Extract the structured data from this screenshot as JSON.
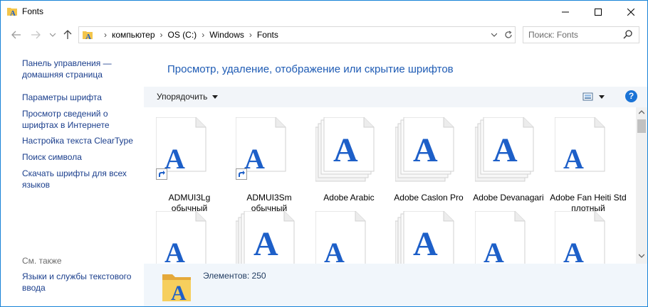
{
  "window": {
    "title": "Fonts"
  },
  "address": {
    "crumbs": [
      "компьютер",
      "OS (C:)",
      "Windows",
      "Fonts"
    ],
    "search_placeholder": "Поиск: Fonts"
  },
  "left_pane": {
    "tasks": [
      "Панель управления — домашняя страница",
      "Параметры шрифта",
      "Просмотр сведений о шрифтах в Интернете",
      "Настройка текста ClearType",
      "Поиск символа",
      "Скачать шрифты для всех языков"
    ],
    "see_also_label": "См. также",
    "see_also_items": [
      "Языки и службы текстового ввода"
    ]
  },
  "main": {
    "heading": "Просмотр, удаление, отображение или скрытие шрифтов",
    "organize_label": "Упорядочить",
    "fonts_row1": [
      {
        "name": "ADMUI3Lg обычный",
        "kind": "shortcut"
      },
      {
        "name": "ADMUI3Sm обычный",
        "kind": "shortcut"
      },
      {
        "name": "Adobe Arabic",
        "kind": "family"
      },
      {
        "name": "Adobe Caslon Pro",
        "kind": "family"
      },
      {
        "name": "Adobe Devanagari",
        "kind": "family"
      },
      {
        "name": "Adobe Fan Heiti Std плотный",
        "kind": "single"
      }
    ],
    "fonts_row2": [
      {
        "kind": "single"
      },
      {
        "kind": "family"
      },
      {
        "kind": "single"
      },
      {
        "kind": "family"
      },
      {
        "kind": "single"
      },
      {
        "kind": "single"
      }
    ]
  },
  "details": {
    "count_text": "Элементов: 250"
  },
  "colors": {
    "accent": "#1883d7",
    "link": "#1a3e8c",
    "heading": "#1e5bb4",
    "glyph": "#1d5fc8"
  }
}
